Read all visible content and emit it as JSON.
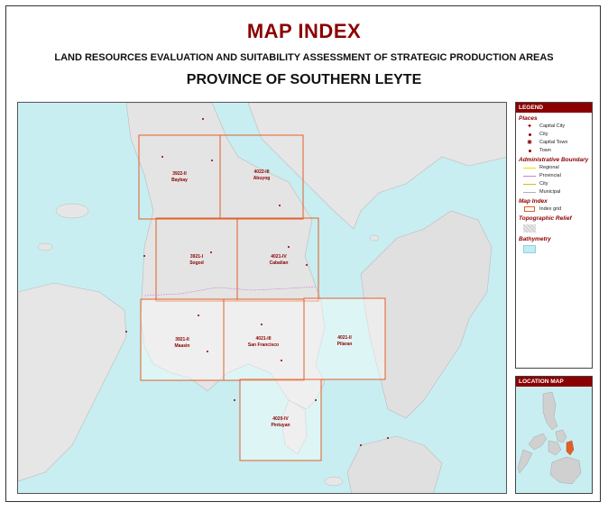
{
  "header": {
    "title": "MAP INDEX",
    "subtitle": "LAND RESOURCES EVALUATION AND SUITABILITY ASSESSMENT OF STRATEGIC PRODUCTION AREAS",
    "province": "PROVINCE OF SOUTHERN LEYTE"
  },
  "colors": {
    "title": "#8b0000",
    "sea": "#c9eef1",
    "land": "#e4e4e4",
    "grid": "#e0602a"
  },
  "grid_cells": [
    {
      "code": "3922-II",
      "name": "Baybay"
    },
    {
      "code": "4022-III",
      "name": "Abuyog"
    },
    {
      "code": "3921-I",
      "name": "Sogod"
    },
    {
      "code": "4021-IV",
      "name": "Cabalian"
    },
    {
      "code": "3921-II",
      "name": "Maasin"
    },
    {
      "code": "4021-III",
      "name": "San Francisco"
    },
    {
      "code": "4021-II",
      "name": "Pilaran"
    },
    {
      "code": "4020-IV",
      "name": "Pintuyan"
    }
  ],
  "legend": {
    "title": "LEGEND",
    "places_title": "Places",
    "places": [
      "Capital City",
      "City",
      "Capital Town",
      "Town"
    ],
    "boundary_title": "Administrative Boundary",
    "boundaries": [
      {
        "label": "Regional",
        "color": "#e8e000"
      },
      {
        "label": "Provincial",
        "color": "#d47cd4"
      },
      {
        "label": "City",
        "color": "#c8c800"
      },
      {
        "label": "Municipal",
        "color": "#b0b0b0"
      }
    ],
    "index_title": "Map Index",
    "index_item": "Index grid",
    "relief_title": "Topographic Relief",
    "bathy_title": "Bathymetry"
  },
  "location_map": {
    "title": "LOCATION MAP"
  }
}
